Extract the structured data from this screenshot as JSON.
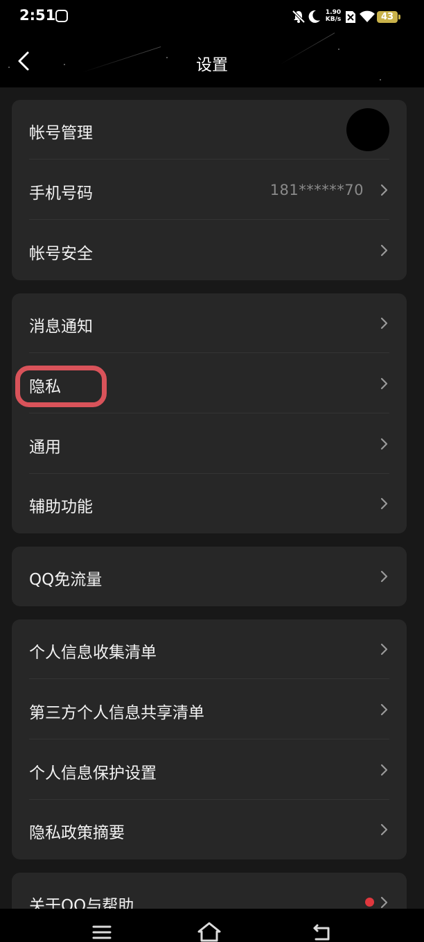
{
  "status_bar": {
    "time": "2:51",
    "speed_value": "1.90",
    "speed_unit": "KB/s",
    "battery": "43",
    "icons": [
      "app-notification-icon",
      "mute-icon",
      "do-not-disturb-icon",
      "no-sim-icon",
      "wifi-icon",
      "battery-icon"
    ]
  },
  "header": {
    "title": "设置",
    "back_icon": "back-arrow-icon"
  },
  "groups": [
    {
      "items": [
        {
          "label": "帐号管理",
          "trailing": "avatar"
        },
        {
          "label": "手机号码",
          "value": "181******70",
          "trailing": "chevron"
        },
        {
          "label": "帐号安全",
          "trailing": "chevron"
        }
      ]
    },
    {
      "items": [
        {
          "label": "消息通知",
          "trailing": "chevron"
        },
        {
          "label": "隐私",
          "trailing": "chevron",
          "highlighted": true
        },
        {
          "label": "通用",
          "trailing": "chevron"
        },
        {
          "label": "辅助功能",
          "trailing": "chevron"
        }
      ]
    },
    {
      "items": [
        {
          "label": "QQ免流量",
          "trailing": "chevron"
        }
      ]
    },
    {
      "items": [
        {
          "label": "个人信息收集清单",
          "trailing": "chevron"
        },
        {
          "label": "第三方个人信息共享清单",
          "trailing": "chevron"
        },
        {
          "label": "个人信息保护设置",
          "trailing": "chevron"
        },
        {
          "label": "隐私政策摘要",
          "trailing": "chevron"
        }
      ]
    },
    {
      "items": [
        {
          "label": "关于QQ与帮助",
          "trailing": "red-dot-chevron"
        }
      ]
    }
  ],
  "colors": {
    "page_background": "#181818",
    "card_background": "#272727",
    "highlight": "#d9535a",
    "badge": "#e0383e",
    "battery": "#c9b24a"
  },
  "nav_bar": {
    "icons": [
      "menu-icon",
      "home-icon",
      "back-icon"
    ]
  }
}
